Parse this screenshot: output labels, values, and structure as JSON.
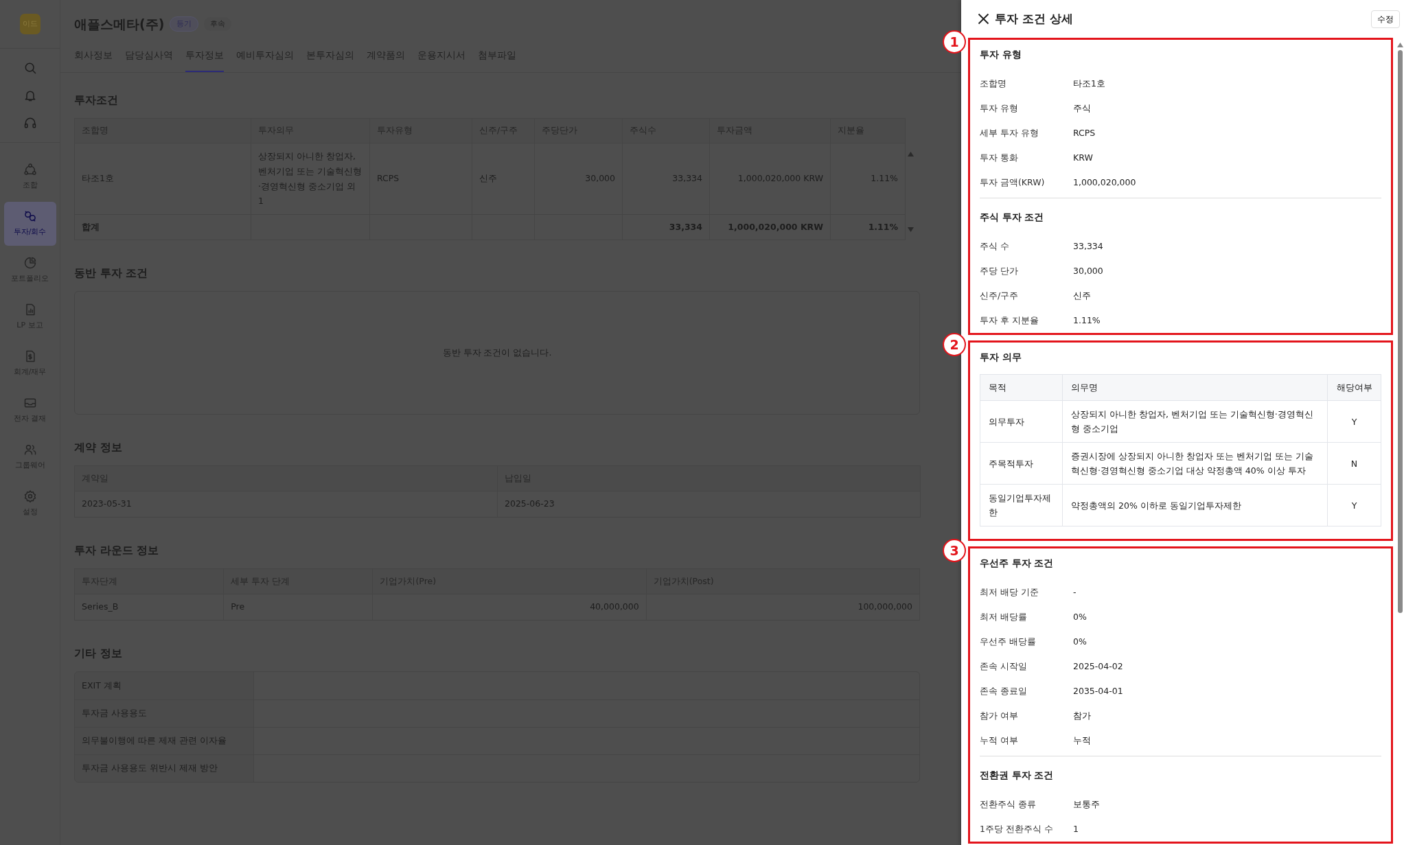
{
  "sidebar": {
    "logo": "이드",
    "items": [
      {
        "label": "조합",
        "selected": false
      },
      {
        "label": "투자/회수",
        "selected": true
      },
      {
        "label": "포트폴리오",
        "selected": false
      },
      {
        "label": "LP 보고",
        "selected": false
      },
      {
        "label": "회계/재무",
        "selected": false
      },
      {
        "label": "전자 결재",
        "selected": false
      },
      {
        "label": "그룹웨어",
        "selected": false
      },
      {
        "label": "설정",
        "selected": false
      }
    ]
  },
  "header": {
    "title": "애플스메타(주)",
    "badges": [
      {
        "label": "등기",
        "kind": "outline"
      },
      {
        "label": "후속",
        "kind": "filled"
      }
    ]
  },
  "tabs": [
    {
      "label": "회사정보",
      "selected": false
    },
    {
      "label": "담당심사역",
      "selected": false
    },
    {
      "label": "투자정보",
      "selected": true
    },
    {
      "label": "예비투자심의",
      "selected": false
    },
    {
      "label": "본투자심의",
      "selected": false
    },
    {
      "label": "계약품의",
      "selected": false
    },
    {
      "label": "운용지시서",
      "selected": false
    },
    {
      "label": "첨부파일",
      "selected": false
    }
  ],
  "investment_terms": {
    "title": "투자조건",
    "columns": [
      "조합명",
      "투자의무",
      "투자유형",
      "신주/구주",
      "주당단가",
      "주식수",
      "투자금액",
      "지분율"
    ],
    "rows": [
      [
        "타조1호",
        "상장되지 아니한 창업자, 벤처기업 또는 기술혁신형·경영혁신형 중소기업 외 1",
        "RCPS",
        "신주",
        "30,000",
        "33,334",
        "1,000,020,000 KRW",
        "1.11%"
      ]
    ],
    "total": {
      "label": "합계",
      "shares": "33,334",
      "amount": "1,000,020,000 KRW",
      "ratio": "1.11%"
    }
  },
  "co_investment": {
    "title": "동반 투자 조건",
    "empty_message": "동반 투자 조건이 없습니다."
  },
  "contract_info": {
    "title": "계약 정보",
    "columns": [
      "계약일",
      "납입일"
    ],
    "rows": [
      [
        "2023-05-31",
        "2025-06-23"
      ]
    ]
  },
  "round_info": {
    "title": "투자 라운드 정보",
    "columns": [
      "투자단계",
      "세부 투자 단계",
      "기업가치(Pre)",
      "기업가치(Post)"
    ],
    "rows": [
      [
        "Series_B",
        "Pre",
        "40,000,000",
        "100,000,000"
      ]
    ]
  },
  "other_info": {
    "title": "기타 정보",
    "rows": [
      {
        "label": "EXIT 계획"
      },
      {
        "label": "투자금 사용용도"
      },
      {
        "label": "의무불이행에 따른 제재 관련 이자율"
      },
      {
        "label": "투자금 사용용도 위반시 제재 방안"
      }
    ]
  },
  "panel": {
    "title": "투자 조건 상세",
    "edit_button": "수정",
    "sections": [
      {
        "marker": "1",
        "groups": [
          {
            "heading": "투자 유형",
            "fields": [
              {
                "label": "조합명",
                "value": "타조1호"
              },
              {
                "label": "투자 유형",
                "value": "주식"
              },
              {
                "label": "세부 투자 유형",
                "value": "RCPS"
              },
              {
                "label": "투자 통화",
                "value": "KRW"
              },
              {
                "label": "투자 금액(KRW)",
                "value": "1,000,020,000"
              }
            ]
          },
          {
            "heading": "주식 투자 조건",
            "fields": [
              {
                "label": "주식 수",
                "value": "33,334"
              },
              {
                "label": "주당 단가",
                "value": "30,000"
              },
              {
                "label": "신주/구주",
                "value": "신주"
              },
              {
                "label": "투자 후 지분율",
                "value": "1.11%"
              }
            ]
          }
        ]
      },
      {
        "marker": "2",
        "groups": [
          {
            "heading": "투자 의무",
            "table": {
              "columns": [
                "목적",
                "의무명",
                "해당여부"
              ],
              "rows": [
                [
                  "의무투자",
                  "상장되지 아니한 창업자, 벤처기업 또는 기술혁신형·경영혁신형 중소기업",
                  "Y"
                ],
                [
                  "주목적투자",
                  "증권시장에 상장되지 아니한 창업자 또는 벤처기업 또는 기술혁신형·경영혁신형 중소기업 대상 약정총액 40% 이상 투자",
                  "N"
                ],
                [
                  "동일기업투자제한",
                  "약정총액의 20% 이하로 동일기업투자제한",
                  "Y"
                ]
              ]
            }
          }
        ]
      },
      {
        "marker": "3",
        "groups": [
          {
            "heading": "우선주 투자 조건",
            "fields": [
              {
                "label": "최저 배당 기준",
                "value": "-"
              },
              {
                "label": "최저 배당률",
                "value": "0%"
              },
              {
                "label": "우선주 배당률",
                "value": "0%"
              },
              {
                "label": "존속 시작일",
                "value": "2025-04-02"
              },
              {
                "label": "존속 종료일",
                "value": "2035-04-01"
              },
              {
                "label": "참가 여부",
                "value": "참가"
              },
              {
                "label": "누적 여부",
                "value": "누적"
              }
            ]
          },
          {
            "heading": "전환권 투자 조건",
            "fields": [
              {
                "label": "전환주식 종류",
                "value": "보통주"
              },
              {
                "label": "1주당 전환주식 수",
                "value": "1"
              }
            ]
          }
        ]
      }
    ]
  }
}
